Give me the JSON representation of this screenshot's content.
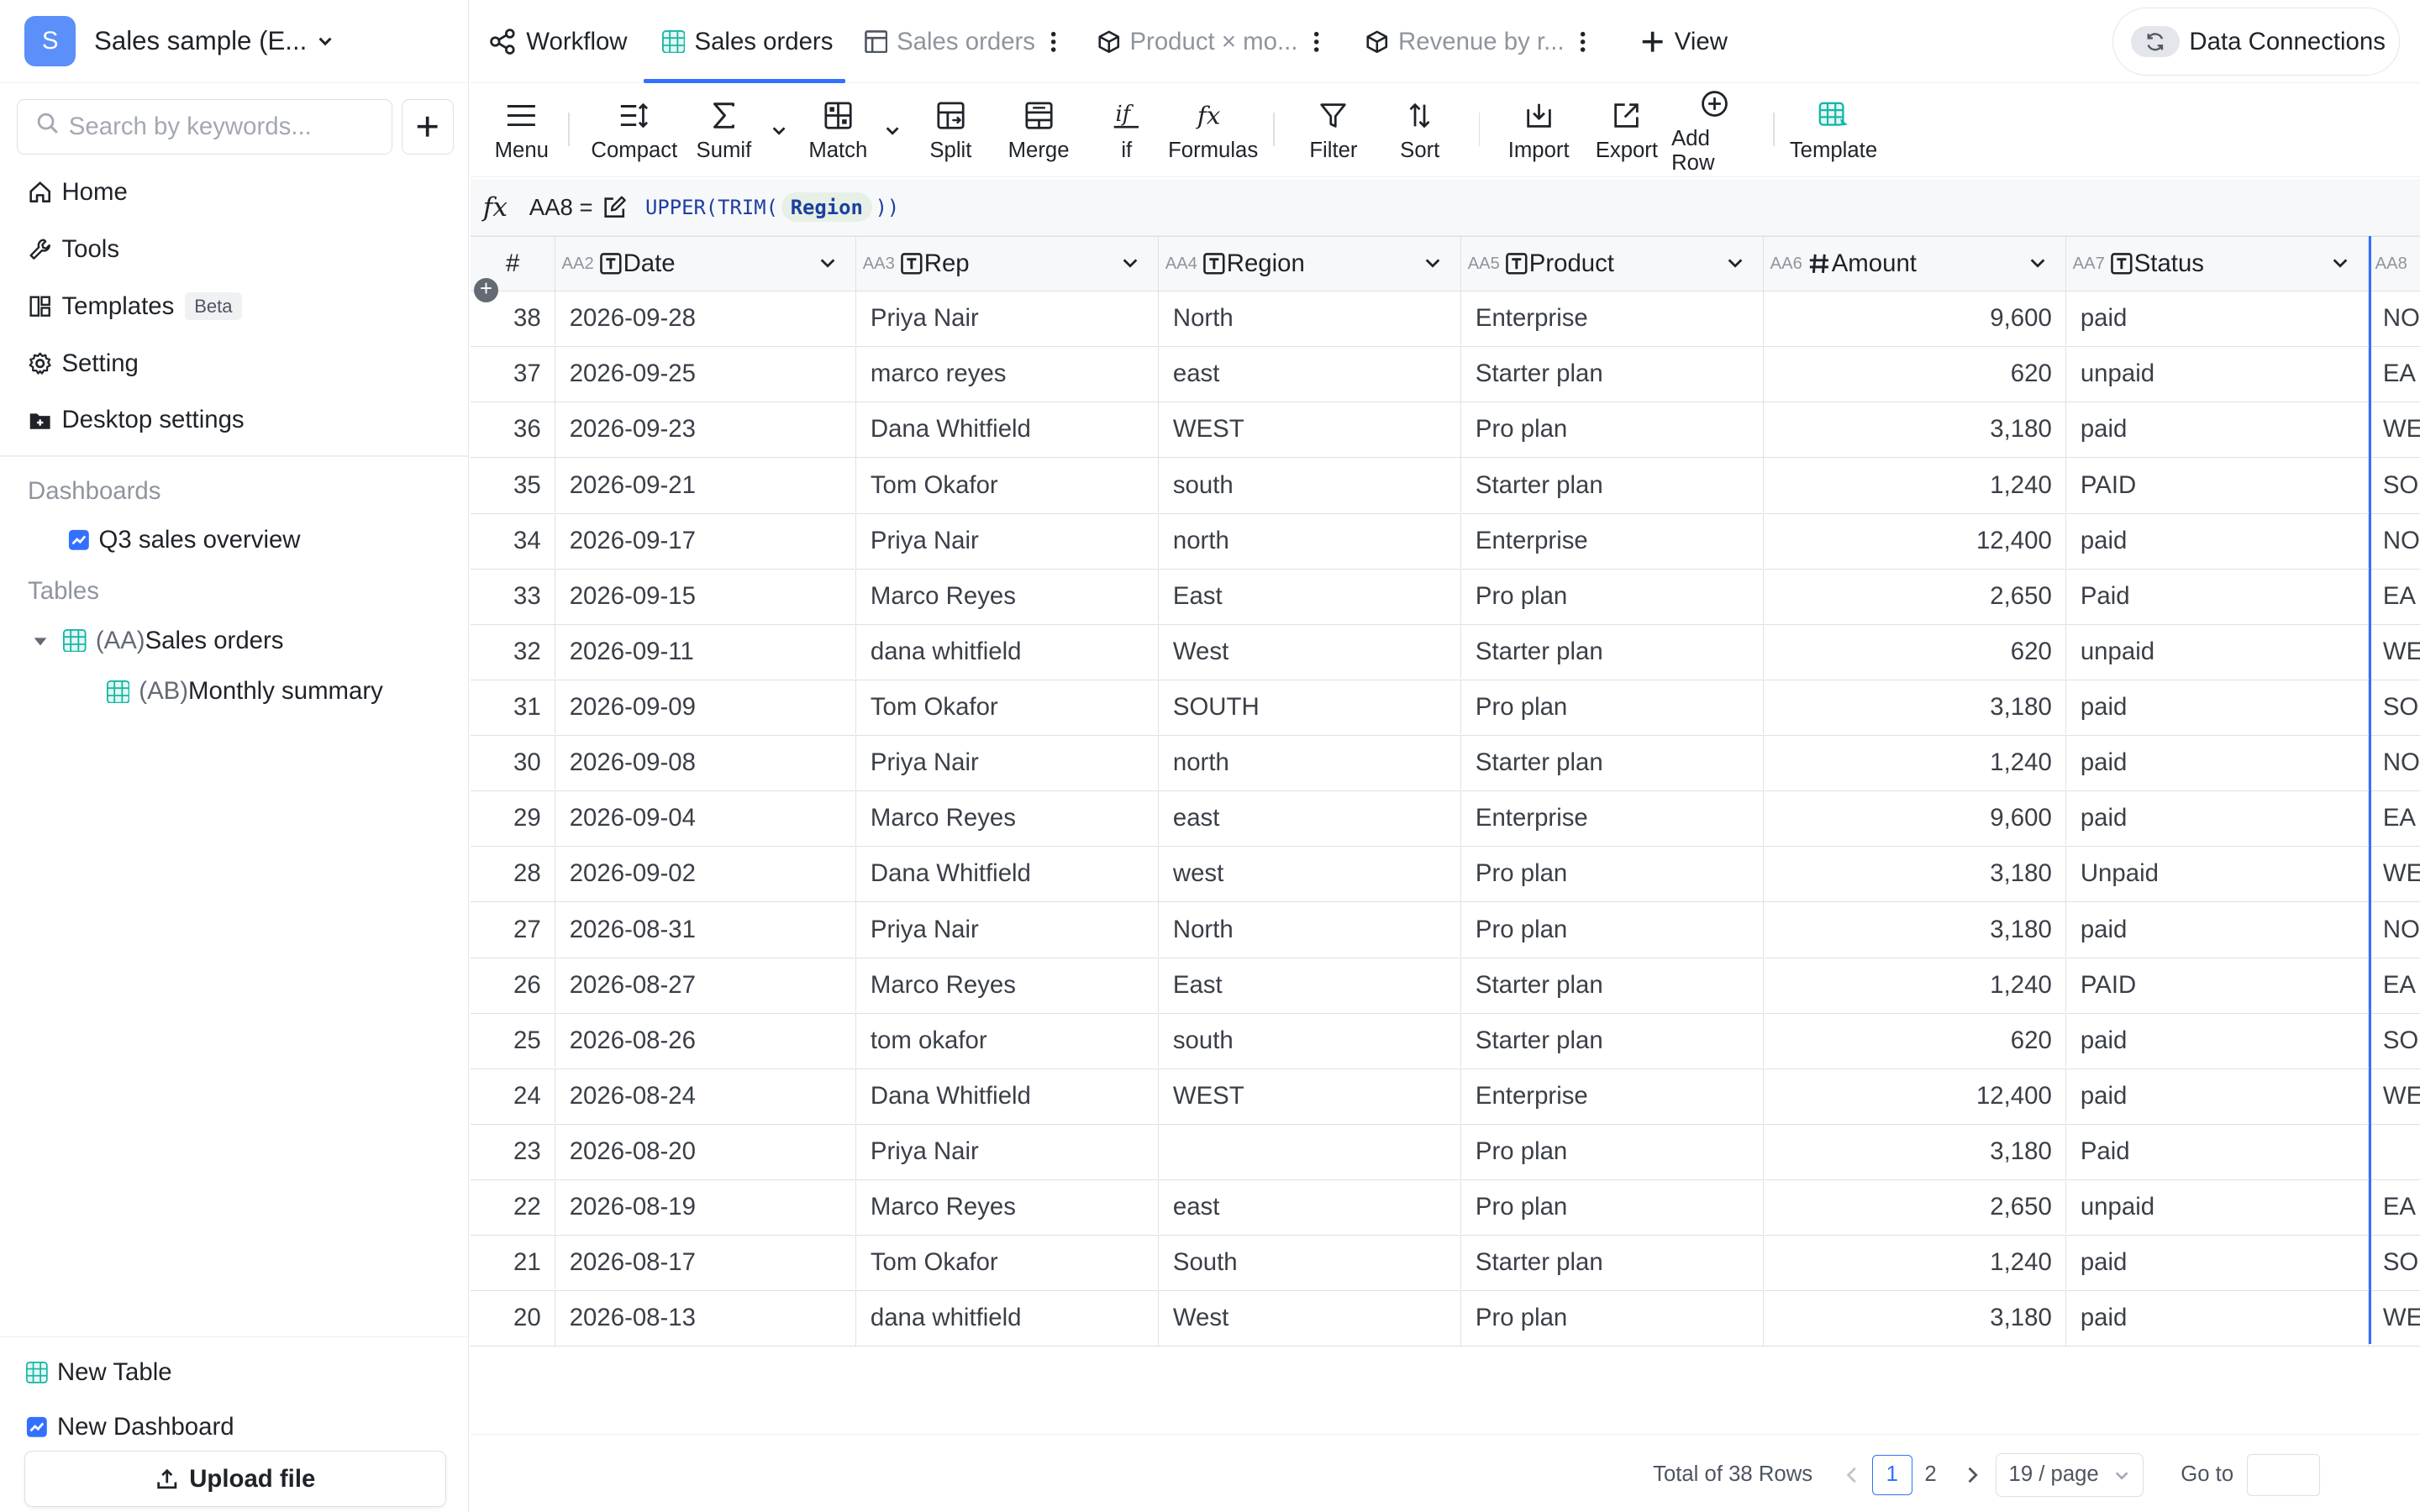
{
  "workspace": {
    "avatar_letter": "S",
    "name": "Sales sample (E..."
  },
  "search": {
    "placeholder": "Search by keywords..."
  },
  "nav": [
    {
      "label": "Home",
      "icon": "home-icon"
    },
    {
      "label": "Tools",
      "icon": "wrench-icon"
    },
    {
      "label": "Templates",
      "icon": "templates-icon",
      "badge": "Beta"
    },
    {
      "label": "Setting",
      "icon": "gear-icon"
    },
    {
      "label": "Desktop settings",
      "icon": "desktop-folder-icon"
    }
  ],
  "dashboards": {
    "title": "Dashboards",
    "items": [
      "Q3 sales overview"
    ]
  },
  "tables": {
    "title": "Tables",
    "items": [
      {
        "prefix": "(AA)",
        "name": "Sales orders"
      },
      {
        "prefix": "(AB)",
        "name": "Monthly summary"
      }
    ]
  },
  "footer": {
    "new_table": "New Table",
    "new_dashboard": "New Dashboard",
    "upload": "Upload file"
  },
  "tabs": {
    "workflow": "Workflow",
    "sales_orders": "Sales orders",
    "sales_orders_2": "Sales orders",
    "product": "Product × mo...",
    "revenue": "Revenue by r...",
    "view": "View"
  },
  "data_connections": "Data Connections",
  "toolbar": {
    "menu": "Menu",
    "compact": "Compact",
    "sumif": "Sumif",
    "match": "Match",
    "split": "Split",
    "merge": "Merge",
    "if": "if",
    "formulas": "Formulas",
    "filter": "Filter",
    "sort": "Sort",
    "import": "Import",
    "export": "Export",
    "add_row": "Add Row",
    "template": "Template"
  },
  "formula_bar": {
    "cell_ref": "AA8 =",
    "func_open": "UPPER(TRIM(",
    "arg": "Region",
    "func_close": "))"
  },
  "columns": [
    {
      "id": "#",
      "name": ""
    },
    {
      "id": "AA2",
      "name": "Date",
      "type": "text"
    },
    {
      "id": "AA3",
      "name": "Rep",
      "type": "text"
    },
    {
      "id": "AA4",
      "name": "Region",
      "type": "text"
    },
    {
      "id": "AA5",
      "name": "Product",
      "type": "text"
    },
    {
      "id": "AA6",
      "name": "Amount",
      "type": "number"
    },
    {
      "id": "AA7",
      "name": "Status",
      "type": "text"
    },
    {
      "id": "AA8",
      "name": ""
    }
  ],
  "rows": [
    {
      "n": "38",
      "date": "2026-09-28",
      "rep": "Priya Nair",
      "region": "North",
      "product": "Enterprise",
      "amount": "9,600",
      "status": "paid",
      "aa8": "NO"
    },
    {
      "n": "37",
      "date": "2026-09-25",
      "rep": "marco reyes",
      "region": "east",
      "product": "Starter plan",
      "amount": "620",
      "status": "unpaid",
      "aa8": "EA"
    },
    {
      "n": "36",
      "date": "2026-09-23",
      "rep": "Dana Whitfield",
      "region": "WEST",
      "product": "Pro plan",
      "amount": "3,180",
      "status": "paid",
      "aa8": "WE"
    },
    {
      "n": "35",
      "date": "2026-09-21",
      "rep": "Tom Okafor",
      "region": "south",
      "product": "Starter plan",
      "amount": "1,240",
      "status": "PAID",
      "aa8": "SO"
    },
    {
      "n": "34",
      "date": "2026-09-17",
      "rep": "Priya Nair",
      "region": "north",
      "product": "Enterprise",
      "amount": "12,400",
      "status": "paid",
      "aa8": "NO"
    },
    {
      "n": "33",
      "date": "2026-09-15",
      "rep": "Marco Reyes",
      "region": "East",
      "product": "Pro plan",
      "amount": "2,650",
      "status": "Paid",
      "aa8": "EA"
    },
    {
      "n": "32",
      "date": "2026-09-11",
      "rep": "dana whitfield",
      "region": "West",
      "product": "Starter plan",
      "amount": "620",
      "status": "unpaid",
      "aa8": "WE"
    },
    {
      "n": "31",
      "date": "2026-09-09",
      "rep": "Tom Okafor",
      "region": "SOUTH",
      "product": "Pro plan",
      "amount": "3,180",
      "status": "paid",
      "aa8": "SO"
    },
    {
      "n": "30",
      "date": "2026-09-08",
      "rep": "Priya Nair",
      "region": "north",
      "product": "Starter plan",
      "amount": "1,240",
      "status": "paid",
      "aa8": "NO"
    },
    {
      "n": "29",
      "date": "2026-09-04",
      "rep": "Marco Reyes",
      "region": "east",
      "product": "Enterprise",
      "amount": "9,600",
      "status": "paid",
      "aa8": "EA"
    },
    {
      "n": "28",
      "date": "2026-09-02",
      "rep": "Dana Whitfield",
      "region": "west",
      "product": "Pro plan",
      "amount": "3,180",
      "status": "Unpaid",
      "aa8": "WE"
    },
    {
      "n": "27",
      "date": "2026-08-31",
      "rep": "Priya Nair",
      "region": "North",
      "product": "Pro plan",
      "amount": "3,180",
      "status": "paid",
      "aa8": "NO"
    },
    {
      "n": "26",
      "date": "2026-08-27",
      "rep": "Marco Reyes",
      "region": "East",
      "product": "Starter plan",
      "amount": "1,240",
      "status": "PAID",
      "aa8": "EA"
    },
    {
      "n": "25",
      "date": "2026-08-26",
      "rep": "tom okafor",
      "region": "south",
      "product": "Starter plan",
      "amount": "620",
      "status": "paid",
      "aa8": "SO"
    },
    {
      "n": "24",
      "date": "2026-08-24",
      "rep": "Dana Whitfield",
      "region": "WEST",
      "product": "Enterprise",
      "amount": "12,400",
      "status": "paid",
      "aa8": "WE"
    },
    {
      "n": "23",
      "date": "2026-08-20",
      "rep": "Priya Nair",
      "region": "",
      "product": "Pro plan",
      "amount": "3,180",
      "status": "Paid",
      "aa8": ""
    },
    {
      "n": "22",
      "date": "2026-08-19",
      "rep": "Marco Reyes",
      "region": "east",
      "product": "Pro plan",
      "amount": "2,650",
      "status": "unpaid",
      "aa8": "EA"
    },
    {
      "n": "21",
      "date": "2026-08-17",
      "rep": "Tom Okafor",
      "region": "South",
      "product": "Starter plan",
      "amount": "1,240",
      "status": "paid",
      "aa8": "SO"
    },
    {
      "n": "20",
      "date": "2026-08-13",
      "rep": "dana whitfield",
      "region": "West",
      "product": "Pro plan",
      "amount": "3,180",
      "status": "paid",
      "aa8": "WE"
    }
  ],
  "pagination": {
    "total": "Total of 38 Rows",
    "pages": [
      "1",
      "2"
    ],
    "page_size": "19 / page",
    "goto": "Go to"
  },
  "colors": {
    "accent": "#3370ff",
    "avatar": "#5b8ff9",
    "table_icon": "#14b8a6"
  }
}
